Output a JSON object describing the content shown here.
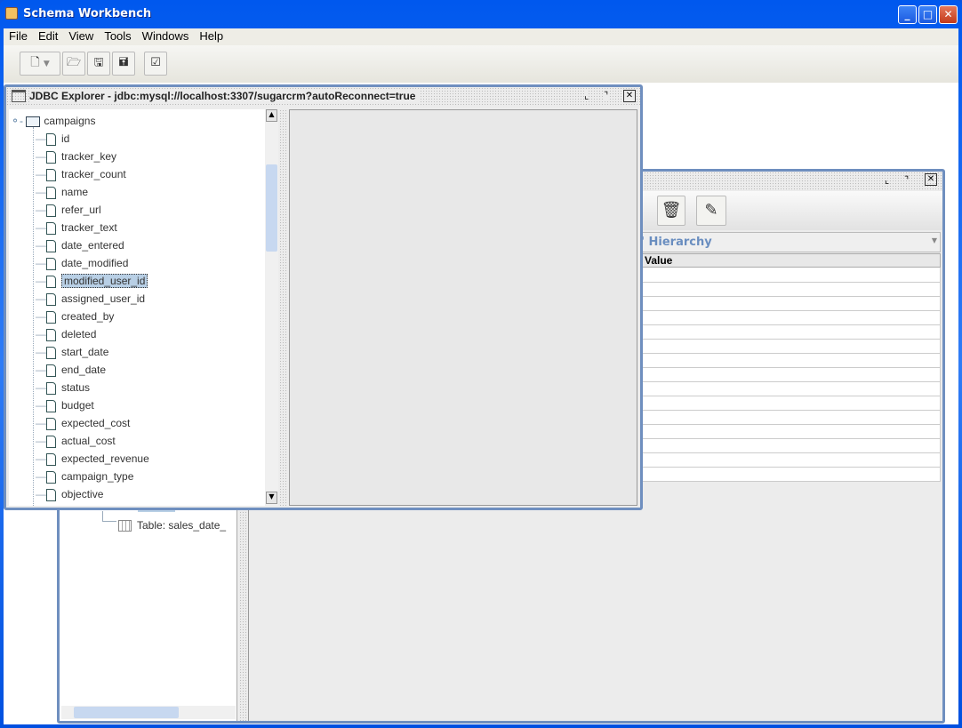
{
  "app": {
    "title": "Schema Workbench"
  },
  "window_controls": {
    "minimize": "_",
    "maximize": "□",
    "close": "✕"
  },
  "menu": [
    "File",
    "Edit",
    "View",
    "Tools",
    "Windows",
    "Help"
  ],
  "toolbar": [
    "new-icon",
    "dropdown-icon",
    "open-icon",
    "save-icon",
    "save-as-icon",
    "preferences-icon"
  ],
  "schema_window": {
    "combo_value": "' Hierarchy",
    "table_header": "Value",
    "tree_item": "Table: sales_date_",
    "row_count": 15
  },
  "jdbc": {
    "title": "JDBC Explorer - jdbc:mysql://localhost:3307/sugarcrm?autoReconnect=true",
    "root": "campaigns",
    "columns": [
      "id",
      "tracker_key",
      "tracker_count",
      "name",
      "refer_url",
      "tracker_text",
      "date_entered",
      "date_modified",
      "modified_user_id",
      "assigned_user_id",
      "created_by",
      "deleted",
      "start_date",
      "end_date",
      "status",
      "budget",
      "expected_cost",
      "actual_cost",
      "expected_revenue",
      "campaign_type",
      "objective"
    ],
    "selected": "modified_user_id"
  }
}
